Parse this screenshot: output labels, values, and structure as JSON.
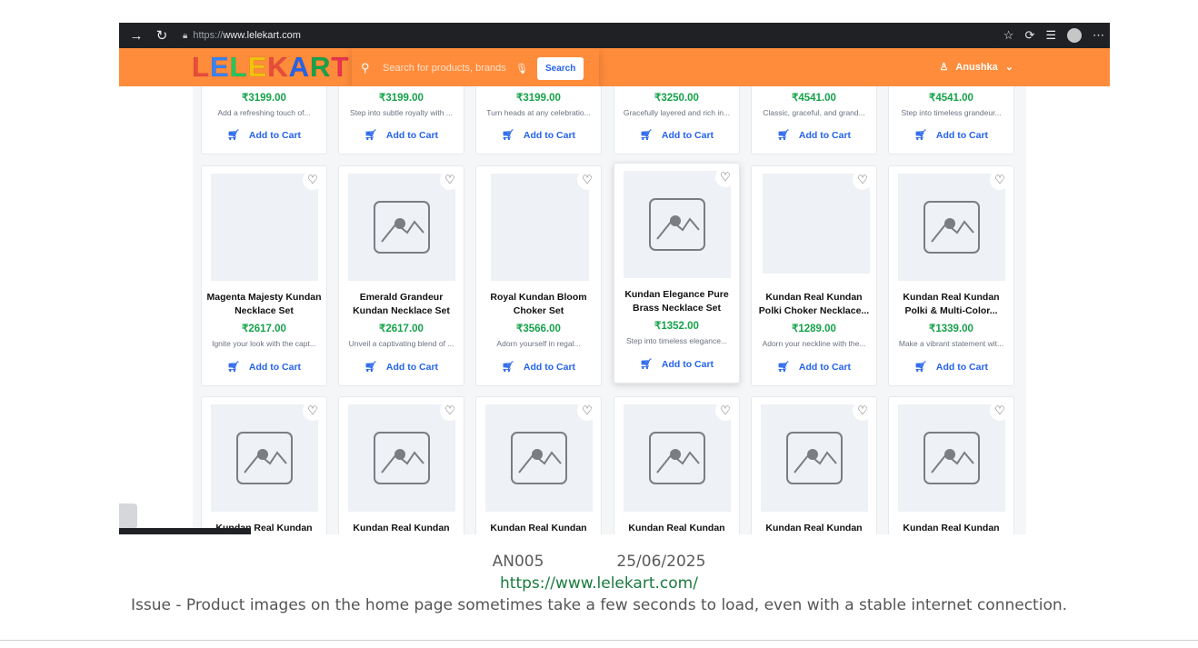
{
  "browser": {
    "url_proto": "https://",
    "url_host": "www.lelekart.com"
  },
  "header": {
    "logo": "LELEKART",
    "logo_colors": [
      "#e94b3c",
      "#3b82f6",
      "#22c55e",
      "#f4c20d",
      "#e94b3c",
      "#2563eb",
      "#16a34a",
      "#e9334f"
    ],
    "search_placeholder": "Search for products, brands",
    "search_button": "Search",
    "user_name": "Anushka"
  },
  "top_row": [
    {
      "price": "₹3199.00",
      "desc": "Add a refreshing touch of...",
      "cart": "Add to Cart"
    },
    {
      "price": "₹3199.00",
      "desc": "Step into subtle royalty with ...",
      "cart": "Add to Cart"
    },
    {
      "price": "₹3199.00",
      "desc": "Turn heads at any celebratio...",
      "cart": "Add to Cart"
    },
    {
      "price": "₹3250.00",
      "desc": "Gracefully layered and rich in...",
      "cart": "Add to Cart"
    },
    {
      "price": "₹4541.00",
      "desc": "Classic, graceful, and grand...",
      "cart": "Add to Cart"
    },
    {
      "price": "₹4541.00",
      "desc": "Step into timeless grandeur...",
      "cart": "Add to Cart"
    }
  ],
  "middle_row": [
    {
      "name": "Magenta Majesty Kundan Necklace Set",
      "price": "₹2617.00",
      "desc": "Ignite your look with the capt...",
      "cart": "Add to Cart",
      "image": "photo"
    },
    {
      "name": "Emerald Grandeur Kundan Necklace Set",
      "price": "₹2617.00",
      "desc": "Unveil a captivating blend of ...",
      "cart": "Add to Cart",
      "image": "placeholder"
    },
    {
      "name": "Royal Kundan Bloom Choker Set",
      "price": "₹3566.00",
      "desc": "Adorn yourself in regal...",
      "cart": "Add to Cart",
      "image": "photo"
    },
    {
      "name": "Kundan Elegance Pure Brass Necklace Set",
      "price": "₹1352.00",
      "desc": "Step into timeless elegance...",
      "cart": "Add to Cart",
      "image": "placeholder"
    },
    {
      "name": "Kundan Real Kundan Polki Choker Necklace...",
      "price": "₹1289.00",
      "desc": "Adorn your neckline with the...",
      "cart": "Add to Cart",
      "image": "photo"
    },
    {
      "name": "Kundan Real Kundan Polki & Multi-Color...",
      "price": "₹1339.00",
      "desc": "Make a vibrant statement wit...",
      "cart": "Add to Cart",
      "image": "placeholder"
    }
  ],
  "bottom_row": [
    {
      "name": "Kundan Real Kundan"
    },
    {
      "name": "Kundan Real Kundan"
    },
    {
      "name": "Kundan Real Kundan"
    },
    {
      "name": "Kundan Real Kundan"
    },
    {
      "name": "Kundan Real Kundan"
    },
    {
      "name": "Kundan Real Kundan"
    }
  ],
  "caption": {
    "id": "AN005",
    "date": "25/06/2025",
    "url": "https://www.lelekart.com/",
    "issue": "Issue - Product images on the home page sometimes take a few seconds to load, even with a stable internet connection."
  }
}
